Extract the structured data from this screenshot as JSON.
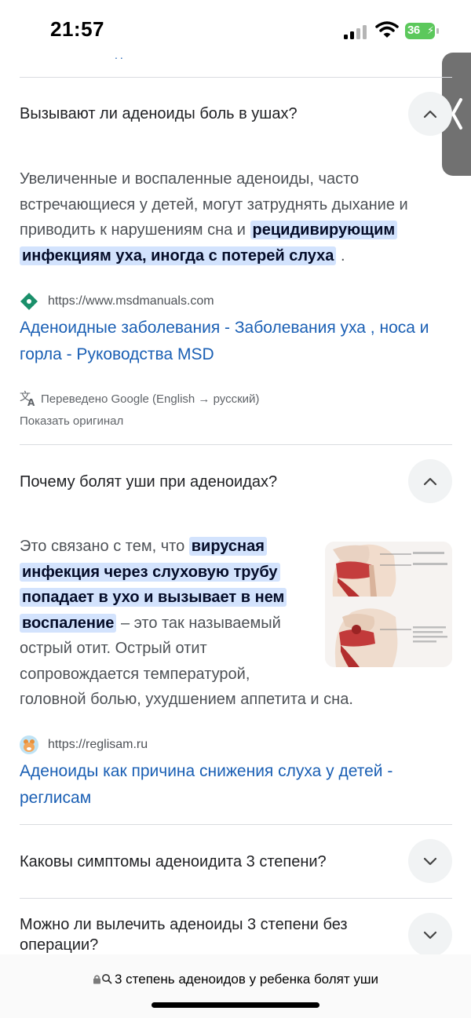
{
  "status_bar": {
    "time": "21:57",
    "battery": "36"
  },
  "faq": [
    {
      "question": "Вызывают ли аденоиды боль в ушах?",
      "expanded": true,
      "answer_lines": [
        "Увеличенные и воспаленные аденоиды, часто",
        "встречающиеся у детей, могут затруднять дыхание и",
        "приводить к нарушениям сна и"
      ],
      "answer_highlight_1": "рецидивирующим",
      "answer_highlight_2": "инфекциям уха, иногда с потерей слуха",
      "answer_tail": ".",
      "source_url": "https://www.msdmanuals.com",
      "link_line1": "Аденоидные заболевания - Заболевания уха , носа и",
      "link_line2": "горла - Руководства MSD",
      "translated_note": "Переведено Google (English → русский)",
      "show_original": "Показать оригинал"
    },
    {
      "question": "Почему болят уши при аденоидах?",
      "expanded": true,
      "answer_start": "Это связано с тем, что",
      "hl_1": "вирусная",
      "hl_2": "инфекция через слуховую трубу",
      "hl_3": "попадает в ухо и вызывает в нем",
      "hl_4": "воспаление",
      "answer_rest_1": "– это так называемый",
      "answer_rest_2": "острый отит. Острый отит",
      "answer_rest_3": "сопровождается температурой,",
      "answer_rest_4": "головной болью, ухудшением аппетита и сна.",
      "source_url": "https://reglisam.ru",
      "link_line1": "Аденоиды как причина снижения слуха у детей -",
      "link_line2": "реглисам"
    },
    {
      "question": "Каковы симптомы аденоидита 3 степени?",
      "expanded": false
    },
    {
      "question_line1": "Можно ли вылечить аденоиды 3 степени без",
      "question_line2": "операции?",
      "expanded": false
    }
  ],
  "address_bar": {
    "text": "3 степень аденоидов у ребенка болят уши"
  },
  "colors": {
    "link": "#1a5fb4",
    "highlight": "#d3e3fd",
    "toggle_bg": "#f1f3f4"
  }
}
